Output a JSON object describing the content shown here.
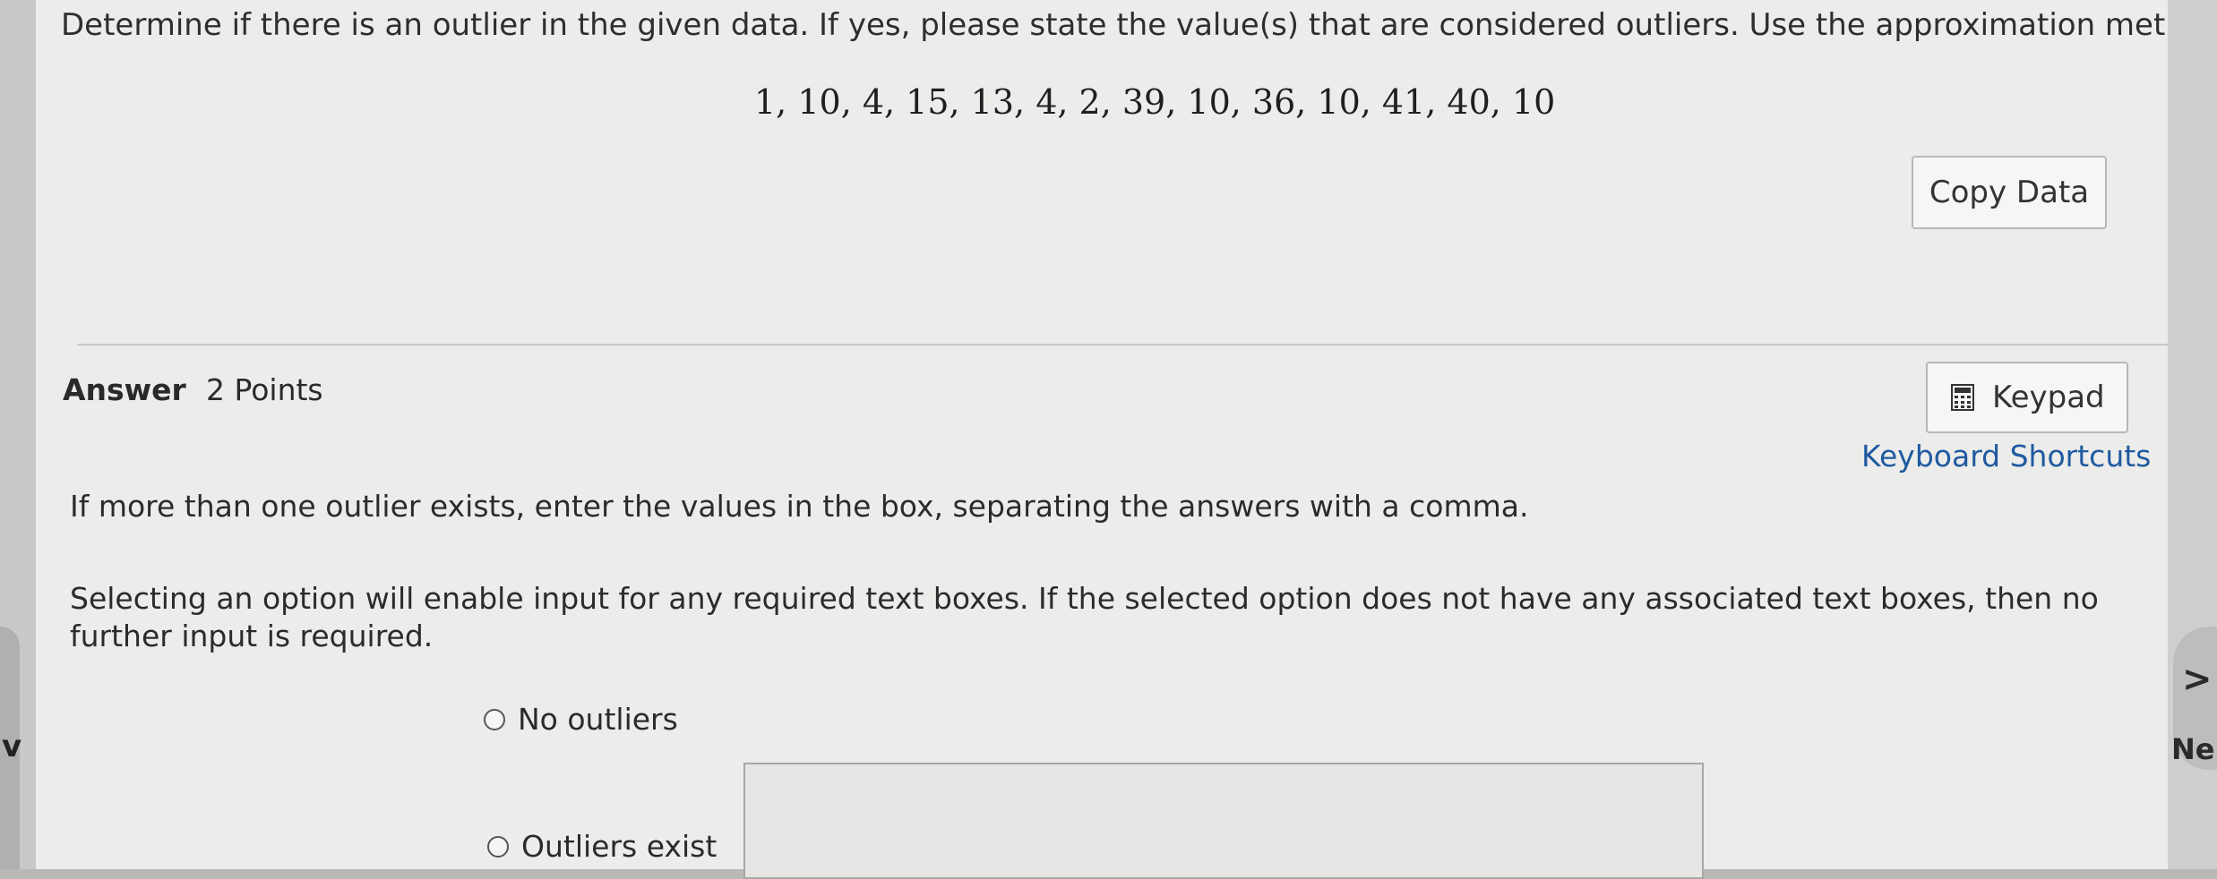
{
  "question": {
    "prompt": "Determine if there is an outlier in the given data. If yes, please state the value(s) that are considered outliers. Use the approximation method.",
    "data_values": "1, 10, 4, 15, 13, 4, 2, 39, 10, 36, 10, 41, 40, 10",
    "copy_button_label": "Copy Data"
  },
  "answer": {
    "heading": "Answer",
    "points": "2 Points",
    "keypad_label": "Keypad",
    "shortcuts_label": "Keyboard Shortcuts",
    "instruction_multiple": "If more than one outlier exists, enter the values in the box, separating the answers with a comma.",
    "instruction_options": "Selecting an option will enable input for any required text boxes. If the selected option does not have any associated text boxes, then no further input is required.",
    "options": [
      {
        "label": "No outliers"
      },
      {
        "label": "Outliers exist"
      }
    ],
    "outliers_input_value": ""
  },
  "nav": {
    "left_glyph": "v",
    "next_glyph": ">",
    "next_label": "Ne"
  }
}
